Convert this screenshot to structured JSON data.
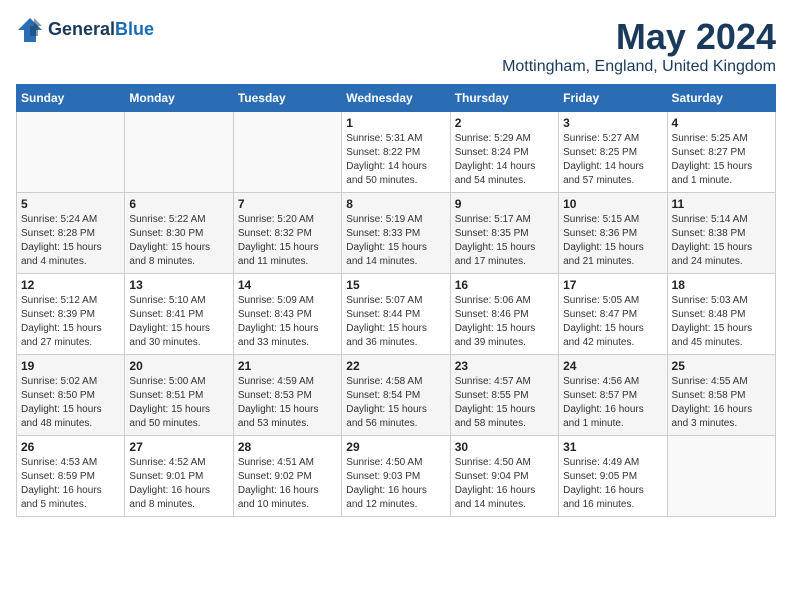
{
  "logo": {
    "line1": "General",
    "line2": "Blue"
  },
  "title": "May 2024",
  "subtitle": "Mottingham, England, United Kingdom",
  "days_of_week": [
    "Sunday",
    "Monday",
    "Tuesday",
    "Wednesday",
    "Thursday",
    "Friday",
    "Saturday"
  ],
  "weeks": [
    [
      {
        "day": "",
        "detail": ""
      },
      {
        "day": "",
        "detail": ""
      },
      {
        "day": "",
        "detail": ""
      },
      {
        "day": "1",
        "detail": "Sunrise: 5:31 AM\nSunset: 8:22 PM\nDaylight: 14 hours\nand 50 minutes."
      },
      {
        "day": "2",
        "detail": "Sunrise: 5:29 AM\nSunset: 8:24 PM\nDaylight: 14 hours\nand 54 minutes."
      },
      {
        "day": "3",
        "detail": "Sunrise: 5:27 AM\nSunset: 8:25 PM\nDaylight: 14 hours\nand 57 minutes."
      },
      {
        "day": "4",
        "detail": "Sunrise: 5:25 AM\nSunset: 8:27 PM\nDaylight: 15 hours\nand 1 minute."
      }
    ],
    [
      {
        "day": "5",
        "detail": "Sunrise: 5:24 AM\nSunset: 8:28 PM\nDaylight: 15 hours\nand 4 minutes."
      },
      {
        "day": "6",
        "detail": "Sunrise: 5:22 AM\nSunset: 8:30 PM\nDaylight: 15 hours\nand 8 minutes."
      },
      {
        "day": "7",
        "detail": "Sunrise: 5:20 AM\nSunset: 8:32 PM\nDaylight: 15 hours\nand 11 minutes."
      },
      {
        "day": "8",
        "detail": "Sunrise: 5:19 AM\nSunset: 8:33 PM\nDaylight: 15 hours\nand 14 minutes."
      },
      {
        "day": "9",
        "detail": "Sunrise: 5:17 AM\nSunset: 8:35 PM\nDaylight: 15 hours\nand 17 minutes."
      },
      {
        "day": "10",
        "detail": "Sunrise: 5:15 AM\nSunset: 8:36 PM\nDaylight: 15 hours\nand 21 minutes."
      },
      {
        "day": "11",
        "detail": "Sunrise: 5:14 AM\nSunset: 8:38 PM\nDaylight: 15 hours\nand 24 minutes."
      }
    ],
    [
      {
        "day": "12",
        "detail": "Sunrise: 5:12 AM\nSunset: 8:39 PM\nDaylight: 15 hours\nand 27 minutes."
      },
      {
        "day": "13",
        "detail": "Sunrise: 5:10 AM\nSunset: 8:41 PM\nDaylight: 15 hours\nand 30 minutes."
      },
      {
        "day": "14",
        "detail": "Sunrise: 5:09 AM\nSunset: 8:43 PM\nDaylight: 15 hours\nand 33 minutes."
      },
      {
        "day": "15",
        "detail": "Sunrise: 5:07 AM\nSunset: 8:44 PM\nDaylight: 15 hours\nand 36 minutes."
      },
      {
        "day": "16",
        "detail": "Sunrise: 5:06 AM\nSunset: 8:46 PM\nDaylight: 15 hours\nand 39 minutes."
      },
      {
        "day": "17",
        "detail": "Sunrise: 5:05 AM\nSunset: 8:47 PM\nDaylight: 15 hours\nand 42 minutes."
      },
      {
        "day": "18",
        "detail": "Sunrise: 5:03 AM\nSunset: 8:48 PM\nDaylight: 15 hours\nand 45 minutes."
      }
    ],
    [
      {
        "day": "19",
        "detail": "Sunrise: 5:02 AM\nSunset: 8:50 PM\nDaylight: 15 hours\nand 48 minutes."
      },
      {
        "day": "20",
        "detail": "Sunrise: 5:00 AM\nSunset: 8:51 PM\nDaylight: 15 hours\nand 50 minutes."
      },
      {
        "day": "21",
        "detail": "Sunrise: 4:59 AM\nSunset: 8:53 PM\nDaylight: 15 hours\nand 53 minutes."
      },
      {
        "day": "22",
        "detail": "Sunrise: 4:58 AM\nSunset: 8:54 PM\nDaylight: 15 hours\nand 56 minutes."
      },
      {
        "day": "23",
        "detail": "Sunrise: 4:57 AM\nSunset: 8:55 PM\nDaylight: 15 hours\nand 58 minutes."
      },
      {
        "day": "24",
        "detail": "Sunrise: 4:56 AM\nSunset: 8:57 PM\nDaylight: 16 hours\nand 1 minute."
      },
      {
        "day": "25",
        "detail": "Sunrise: 4:55 AM\nSunset: 8:58 PM\nDaylight: 16 hours\nand 3 minutes."
      }
    ],
    [
      {
        "day": "26",
        "detail": "Sunrise: 4:53 AM\nSunset: 8:59 PM\nDaylight: 16 hours\nand 5 minutes."
      },
      {
        "day": "27",
        "detail": "Sunrise: 4:52 AM\nSunset: 9:01 PM\nDaylight: 16 hours\nand 8 minutes."
      },
      {
        "day": "28",
        "detail": "Sunrise: 4:51 AM\nSunset: 9:02 PM\nDaylight: 16 hours\nand 10 minutes."
      },
      {
        "day": "29",
        "detail": "Sunrise: 4:50 AM\nSunset: 9:03 PM\nDaylight: 16 hours\nand 12 minutes."
      },
      {
        "day": "30",
        "detail": "Sunrise: 4:50 AM\nSunset: 9:04 PM\nDaylight: 16 hours\nand 14 minutes."
      },
      {
        "day": "31",
        "detail": "Sunrise: 4:49 AM\nSunset: 9:05 PM\nDaylight: 16 hours\nand 16 minutes."
      },
      {
        "day": "",
        "detail": ""
      }
    ]
  ]
}
